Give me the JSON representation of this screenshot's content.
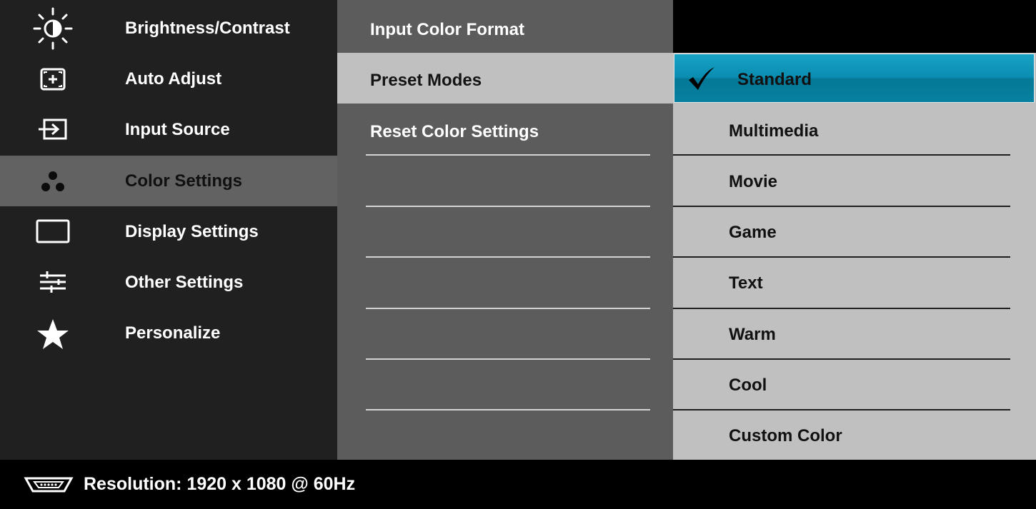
{
  "main_menu": [
    {
      "label": "Brightness/Contrast",
      "icon": "brightness-icon",
      "selected": false
    },
    {
      "label": "Auto Adjust",
      "icon": "auto-adjust-icon",
      "selected": false
    },
    {
      "label": "Input Source",
      "icon": "input-source-icon",
      "selected": false
    },
    {
      "label": "Color Settings",
      "icon": "color-settings-icon",
      "selected": true
    },
    {
      "label": "Display Settings",
      "icon": "display-settings-icon",
      "selected": false
    },
    {
      "label": "Other Settings",
      "icon": "other-settings-icon",
      "selected": false
    },
    {
      "label": "Personalize",
      "icon": "star-icon",
      "selected": false
    }
  ],
  "submenu": [
    {
      "label": "Input Color Format",
      "selected": false
    },
    {
      "label": "Preset Modes",
      "selected": true
    },
    {
      "label": "Reset Color Settings",
      "selected": false
    }
  ],
  "preset_modes": [
    {
      "label": "Standard",
      "selected": true,
      "checked": true
    },
    {
      "label": "Multimedia",
      "selected": false
    },
    {
      "label": "Movie",
      "selected": false
    },
    {
      "label": "Game",
      "selected": false
    },
    {
      "label": "Text",
      "selected": false
    },
    {
      "label": "Warm",
      "selected": false
    },
    {
      "label": "Cool",
      "selected": false
    },
    {
      "label": "Custom Color",
      "selected": false
    }
  ],
  "status": {
    "label": "Resolution: 1920 x 1080 @ 60Hz",
    "icon": "vga-connector-icon"
  },
  "colors": {
    "highlight": "#0a8db0",
    "selected_main": "#626262",
    "selected_sub": "#c0c0c0"
  }
}
